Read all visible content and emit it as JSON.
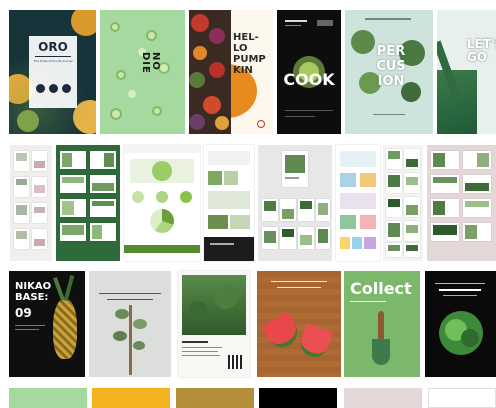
{
  "colors": {
    "green_light": "#a6d9a0",
    "orange": "#f4b120",
    "brown": "#b58e3c",
    "black": "#000000",
    "pink": "#e4d7d8",
    "white": "#ffffff",
    "dark_green": "#2e6a3a",
    "navy": "#1b2a3c",
    "mint": "#cfe3dd"
  },
  "row1": {
    "oro_title": "ORO",
    "oro_sub": "The Tropical Foods Journal",
    "nodie_text": "NO\nDIE",
    "pumpkin_text": "HEL-\nLO\nPUMP\nKIN",
    "cook_text": "COOK",
    "percussion_text": "PER\nCUS\nION",
    "letsgo_text": "LET'S\nGO"
  },
  "row3": {
    "nikao_text": "NIKAO\nBASE:",
    "nikao_number": "09",
    "collect_text": "Collect"
  },
  "swatches": [
    {
      "name": "swatch-green",
      "color": "#a6d9a0"
    },
    {
      "name": "swatch-orange",
      "color": "#f4b120"
    },
    {
      "name": "swatch-brown",
      "color": "#b58e3c"
    },
    {
      "name": "swatch-black",
      "color": "#000000"
    },
    {
      "name": "swatch-pink",
      "color": "#e4d7d8"
    },
    {
      "name": "swatch-white",
      "color": "#ffffff"
    }
  ]
}
